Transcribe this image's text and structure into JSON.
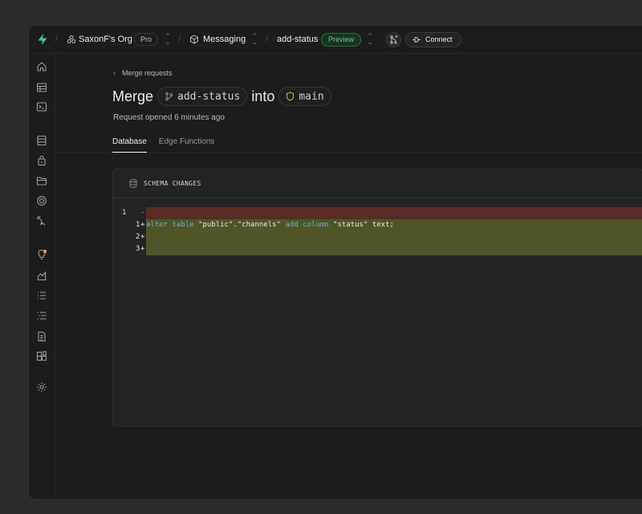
{
  "topbar": {
    "org_name": "SaxonF's Org",
    "plan_badge": "Pro",
    "project_name": "Messaging",
    "branch_name": "add-status",
    "branch_badge": "Preview",
    "connect_label": "Connect"
  },
  "page": {
    "back_label": "Merge requests",
    "title_merge": "Merge",
    "source_branch": "add-status",
    "title_into": "into",
    "target_branch": "main",
    "subtitle": "Request opened 6 minutes ago",
    "tabs": [
      {
        "label": "Database",
        "active": true
      },
      {
        "label": "Edge Functions",
        "active": false
      }
    ]
  },
  "schema": {
    "header": "SCHEMA CHANGES",
    "lines": [
      {
        "old": "1",
        "new": "",
        "mark": "-",
        "type": "deleted",
        "text": ""
      },
      {
        "old": "",
        "new": "1",
        "mark": "+",
        "type": "added",
        "text": "alter table \"public\".\"channels\" add column \"status\" text;"
      },
      {
        "old": "",
        "new": "2",
        "mark": "+",
        "type": "added",
        "text": ""
      },
      {
        "old": "",
        "new": "3",
        "mark": "+",
        "type": "added",
        "text": ""
      }
    ]
  },
  "colors": {
    "accent_green": "#3ecf8e",
    "deleted_bg": "#5a2a26",
    "added_bg": "#4f5527"
  },
  "icons": {
    "sidebar": [
      "home-icon",
      "table-editor-icon",
      "sql-editor-icon",
      "database-icon",
      "auth-icon",
      "storage-icon",
      "realtime-icon",
      "edge-functions-icon",
      "advisors-icon",
      "reports-icon",
      "logs-icon",
      "api-docs-icon",
      "docs-icon",
      "integrations-icon",
      "settings-icon"
    ]
  }
}
